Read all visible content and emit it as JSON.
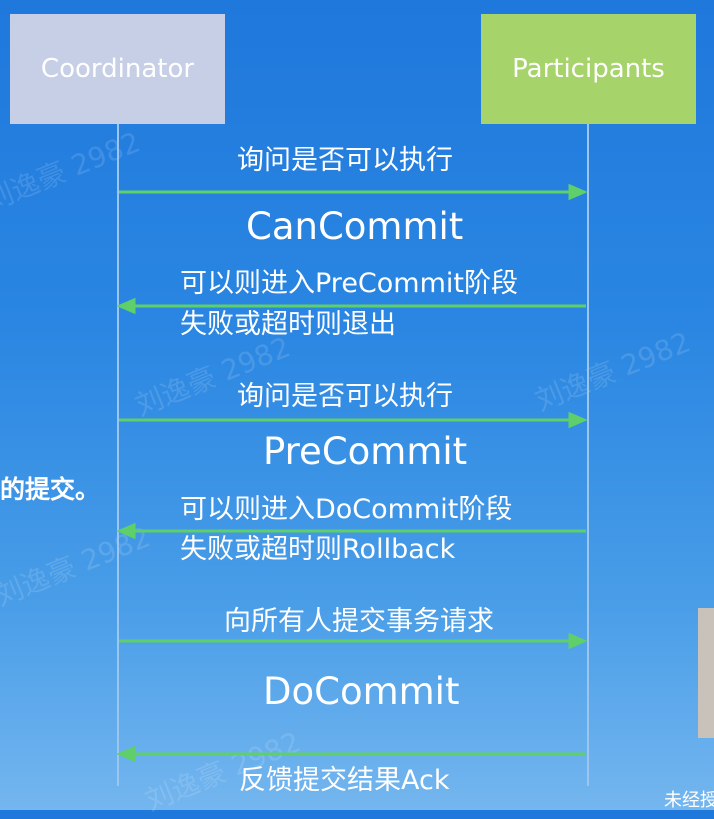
{
  "actors": {
    "coordinator": "Coordinator",
    "participants": "Participants"
  },
  "messages": [
    {
      "label": "询问是否可以执行",
      "direction": "right"
    },
    {
      "label": "可以则进入PreCommit阶段",
      "sub": "失败或超时则退出",
      "direction": "left"
    },
    {
      "label": "询问是否可以执行",
      "direction": "right"
    },
    {
      "label": "可以则进入DoCommit阶段",
      "sub": "失败或超时则Rollback",
      "direction": "left"
    },
    {
      "label": "向所有人提交事务请求",
      "direction": "right"
    },
    {
      "label": "反馈提交结果Ack",
      "direction": "left"
    }
  ],
  "phases": [
    "CanCommit",
    "PreCommit",
    "DoCommit"
  ],
  "side_text": "的提交。",
  "corner_text": "未经授",
  "watermark": "刘逸豪 2982",
  "colors": {
    "coordinator_box": "#c6cfe6",
    "participants_box": "#a6d36a",
    "arrow": "#5fcf6a",
    "background": "#2a86e2"
  }
}
